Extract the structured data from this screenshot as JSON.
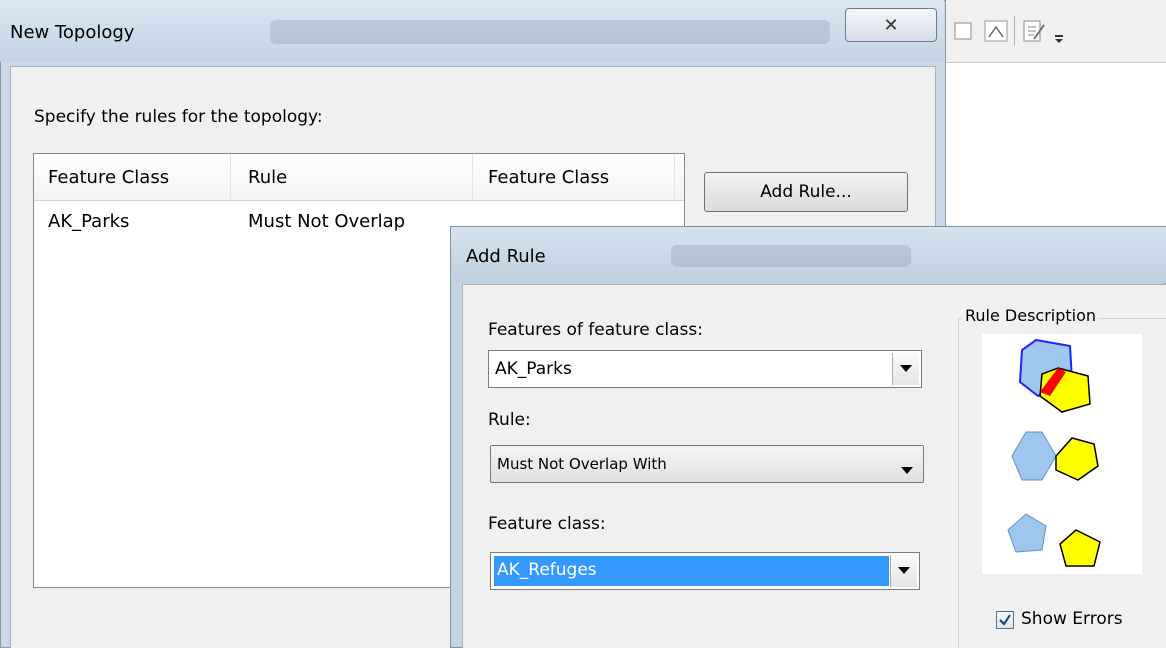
{
  "new_topology": {
    "title": "New Topology",
    "close_glyph": "✕",
    "prompt": "Specify the rules for the topology:",
    "columns": [
      "Feature Class",
      "Rule",
      "Feature Class"
    ],
    "rows": [
      {
        "feature_class": "AK_Parks",
        "rule": "Must Not Overlap",
        "feature_class_2": ""
      }
    ],
    "add_rule_label": "Add Rule..."
  },
  "add_rule": {
    "title": "Add Rule",
    "features_label": "Features of feature class:",
    "features_value": "AK_Parks",
    "rule_label": "Rule:",
    "rule_value": "Must Not Overlap With",
    "feature_class_label": "Feature class:",
    "feature_class_value": "AK_Refuges",
    "description_legend": "Rule Description",
    "show_errors_label": "Show Errors",
    "show_errors_checked": true
  },
  "colors": {
    "selection": "#3399ff",
    "shape_blue": "#9ec7ee",
    "shape_yellow": "#ffff00",
    "error_red": "#ff0000"
  }
}
